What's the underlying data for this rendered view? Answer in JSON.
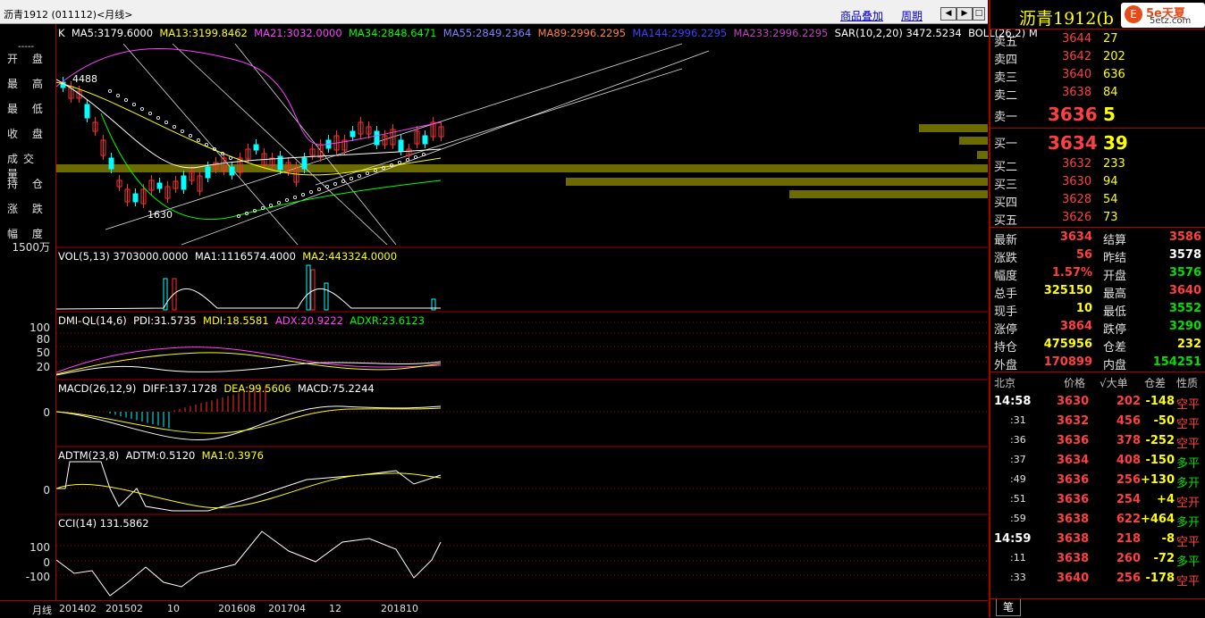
{
  "window": {
    "title": "沥青1912 (011112)<月线>",
    "overlay_link": "商品叠加",
    "period_link": "周期"
  },
  "left_labels": [
    "开 盘",
    "最 高",
    "最 低",
    "收 盘",
    "成交量",
    "持 仓",
    "涨 跌",
    "幅 度"
  ],
  "left_dashes": "-----",
  "main_panel": {
    "k": "K",
    "ma5": "MA5:3179.6000",
    "ma13": "MA13:3199.8462",
    "ma21": "MA21:3032.0000",
    "ma34": "MA34:2848.6471",
    "ma55": "MA55:2849.2364",
    "ma89": "MA89:2996.2295",
    "ma144": "MA144:2996.2295",
    "ma233": "MA233:2996.2295",
    "sar": "SAR(10,2,20)  3472.5234",
    "boll": "BOLL(26,2)  M",
    "high_mark": "4488",
    "low_mark": "1630"
  },
  "vol_panel": {
    "title": "VOL(5,13)  3703000.0000",
    "ma1": "MA1:1116574.4000",
    "ma2": "MA2:443324.0000",
    "y_label": "1500万"
  },
  "dmi_panel": {
    "title": "DMI-QL(14,6)",
    "pdi": "PDI:31.5735",
    "mdi": "MDI:18.5581",
    "adx": "ADX:20.9222",
    "adxr": "ADXR:23.6123",
    "y_labels": [
      "100",
      "80",
      "50",
      "20"
    ]
  },
  "macd_panel": {
    "title": "MACD(26,12,9)",
    "diff": "DIFF:137.1728",
    "dea": "DEA:99.5606",
    "macd": "MACD:75.2244",
    "y_label": "0"
  },
  "adtm_panel": {
    "title": "ADTM(23,8)",
    "adtm": "ADTM:0.5120",
    "ma1": "MA1:0.3976",
    "y_label": "0"
  },
  "cci_panel": {
    "title": "CCI(14)  131.5862",
    "y_labels": [
      "100",
      "0",
      "-100"
    ]
  },
  "x_axis": {
    "period": "月线",
    "labels": [
      "201402",
      "201502",
      "10",
      "201608",
      "201704",
      "12",
      "201810"
    ]
  },
  "quote": {
    "title": "沥青1912(b",
    "logo": "5e天夏",
    "logo_sub": "5etz.com",
    "asks": [
      {
        "label": "卖五",
        "price": "3644",
        "vol": "27"
      },
      {
        "label": "卖四",
        "price": "3642",
        "vol": "202"
      },
      {
        "label": "卖三",
        "price": "3640",
        "vol": "636"
      },
      {
        "label": "卖二",
        "price": "3638",
        "vol": "84"
      },
      {
        "label": "卖一",
        "price": "3636",
        "vol": "5"
      }
    ],
    "bids": [
      {
        "label": "买一",
        "price": "3634",
        "vol": "39"
      },
      {
        "label": "买二",
        "price": "3632",
        "vol": "233"
      },
      {
        "label": "买三",
        "price": "3630",
        "vol": "94"
      },
      {
        "label": "买四",
        "price": "3628",
        "vol": "54"
      },
      {
        "label": "买五",
        "price": "3626",
        "vol": "73"
      }
    ],
    "stats": [
      {
        "l1": "最新",
        "v1": "3634",
        "l2": "结算",
        "v2": "3586"
      },
      {
        "l1": "涨跌",
        "v1": "56",
        "l2": "昨结",
        "v2": "3578"
      },
      {
        "l1": "幅度",
        "v1": "1.57%",
        "l2": "开盘",
        "v2": "3576"
      },
      {
        "l1": "总手",
        "v1": "325150",
        "l2": "最高",
        "v2": "3640"
      },
      {
        "l1": "现手",
        "v1": "10",
        "l2": "最低",
        "v2": "3552"
      },
      {
        "l1": "涨停",
        "v1": "3864",
        "l2": "跌停",
        "v2": "3290"
      },
      {
        "l1": "持仓",
        "v1": "475956",
        "l2": "仓差",
        "v2": "232"
      },
      {
        "l1": "外盘",
        "v1": "170899",
        "l2": "内盘",
        "v2": "154251"
      }
    ],
    "tick_header": {
      "loc": "北京",
      "price": "价格",
      "big": "√大单",
      "diff": "仓差",
      "nature": "性质"
    },
    "ticks": [
      {
        "time": "14:58",
        "price": "3630",
        "vol": "202",
        "diff": "-148",
        "nature": "空平"
      },
      {
        "time": ":31",
        "price": "3632",
        "vol": "456",
        "diff": "-50",
        "nature": "空平"
      },
      {
        "time": ":36",
        "price": "3636",
        "vol": "378",
        "diff": "-252",
        "nature": "空平"
      },
      {
        "time": ":37",
        "price": "3634",
        "vol": "408",
        "diff": "-150",
        "nature": "多平"
      },
      {
        "time": ":49",
        "price": "3636",
        "vol": "256",
        "diff": "+130",
        "nature": "多开"
      },
      {
        "time": ":51",
        "price": "3636",
        "vol": "254",
        "diff": "+4",
        "nature": "空开"
      },
      {
        "time": ":59",
        "price": "3638",
        "vol": "622",
        "diff": "+464",
        "nature": "多开"
      },
      {
        "time": "14:59",
        "price": "3638",
        "vol": "218",
        "diff": "-8",
        "nature": "空平"
      },
      {
        "time": ":11",
        "price": "3638",
        "vol": "260",
        "diff": "-72",
        "nature": "多平"
      },
      {
        "time": ":33",
        "price": "3640",
        "vol": "256",
        "diff": "-178",
        "nature": "空平"
      }
    ],
    "bottom_tab": "笔"
  }
}
